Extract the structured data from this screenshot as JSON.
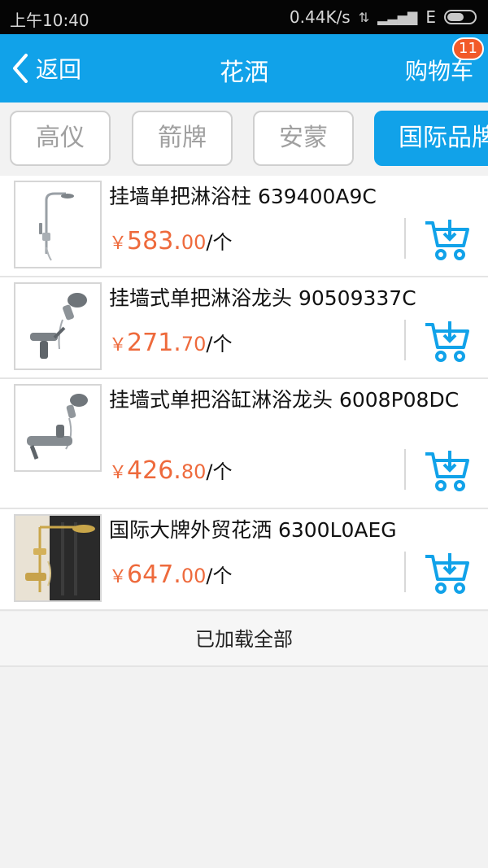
{
  "status_bar": {
    "time": "上午10:40",
    "speed": "0.44K/s",
    "network": "E"
  },
  "nav": {
    "back_label": "返回",
    "title": "花洒",
    "cart_label": "购物车",
    "cart_badge": "11"
  },
  "brands": [
    {
      "label": "高仪",
      "active": false
    },
    {
      "label": "箭牌",
      "active": false
    },
    {
      "label": "安蒙",
      "active": false
    },
    {
      "label": "国际品牌",
      "active": true
    }
  ],
  "products": [
    {
      "title": "挂墙单把淋浴柱 639400A9C",
      "currency": "￥",
      "price_int": "583.",
      "price_dec": "00",
      "unit": "/个",
      "image": "shower-column-icon"
    },
    {
      "title": "挂墙式单把淋浴龙头 90509337C",
      "currency": "￥",
      "price_int": "271.",
      "price_dec": "70",
      "unit": "/个",
      "image": "shower-faucet-icon"
    },
    {
      "title": "挂墙式单把浴缸淋浴龙头 6008P08DC",
      "currency": "￥",
      "price_int": "426.",
      "price_dec": "80",
      "unit": "/个",
      "image": "bath-shower-faucet-icon"
    },
    {
      "title": "国际大牌外贸花洒 6300L0AEG",
      "currency": "￥",
      "price_int": "647.",
      "price_dec": "00",
      "unit": "/个",
      "image": "gold-shower-set-icon"
    }
  ],
  "footer_note": "已加载全部",
  "colors": {
    "primary": "#11a2e9",
    "price": "#ee6a3c",
    "badge": "#f25a29"
  }
}
